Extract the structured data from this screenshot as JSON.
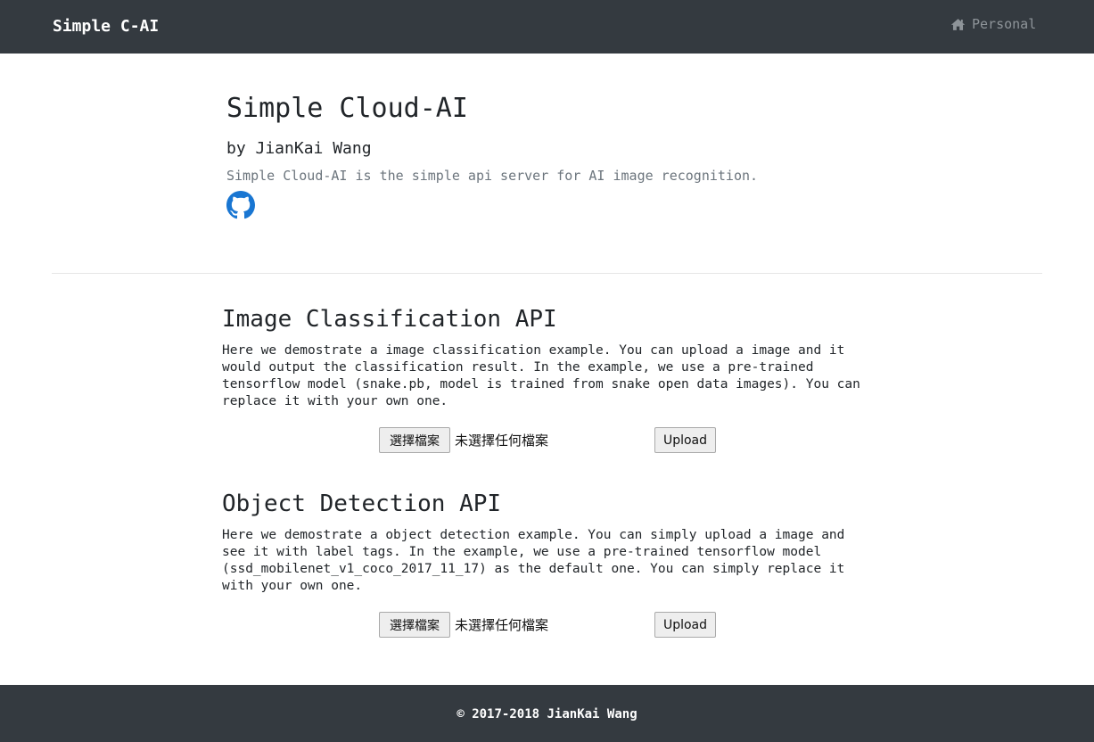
{
  "navbar": {
    "brand": "Simple C-AI",
    "link_label": "Personal",
    "link_icon": "home-icon"
  },
  "header": {
    "title": "Simple Cloud-AI",
    "byline": "by JianKai Wang",
    "lead": "Simple Cloud-AI is the simple api server for AI image recognition.",
    "repo_icon": "github-icon"
  },
  "sections": [
    {
      "heading": "Image Classification API",
      "description_lines": [
        "Here we demostrate a image classification example. You can upload a image and it",
        "would output the classification result. In the example, we use a pre-trained",
        "tensorflow model (snake.pb, model is trained from snake open data images). You can",
        "replace it with your own one."
      ],
      "file_button": "選擇檔案",
      "file_status": "未選擇任何檔案",
      "upload_button": "Upload"
    },
    {
      "heading": "Object Detection API",
      "description_lines": [
        "Here we demostrate a object detection example. You can simply upload a image and",
        "see it with label tags. In the example, we use a pre-trained tensorflow model",
        "(ssd_mobilenet_v1_coco_2017_11_17) as the default one. You can simply replace it",
        "with your own one."
      ],
      "file_button": "選擇檔案",
      "file_status": "未選擇任何檔案",
      "upload_button": "Upload"
    }
  ],
  "footer": {
    "text": "© 2017-2018 JianKai Wang"
  },
  "colors": {
    "navbar_bg": "#343a40",
    "muted_text": "#6c757d",
    "github_blue": "#1976d2"
  }
}
